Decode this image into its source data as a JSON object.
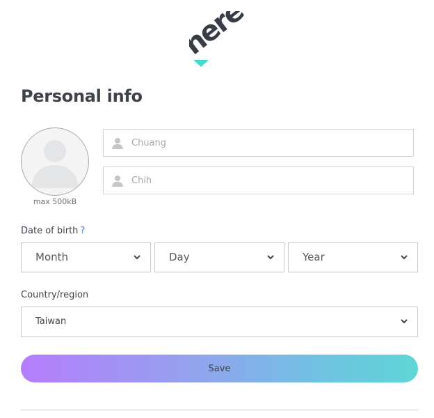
{
  "brand": {
    "logo_text": "here",
    "logo_color": "#383c45",
    "accent_color": "#48dad0"
  },
  "page": {
    "title": "Personal info"
  },
  "avatar": {
    "hint": "max 500kB",
    "icon": "user-silhouette-icon"
  },
  "name_fields": {
    "first": {
      "placeholder": "Chuang",
      "value": "",
      "icon": "person-icon"
    },
    "last": {
      "placeholder": "Chih",
      "value": "",
      "icon": "person-icon"
    }
  },
  "dob": {
    "label": "Date of birth",
    "help": "?",
    "month": "Month",
    "day": "Day",
    "year": "Year"
  },
  "country": {
    "label": "Country/region",
    "selected": "Taiwan"
  },
  "save": {
    "label": "Save",
    "gradient_start": "#b57dfb",
    "gradient_end": "#5ed6d6"
  }
}
